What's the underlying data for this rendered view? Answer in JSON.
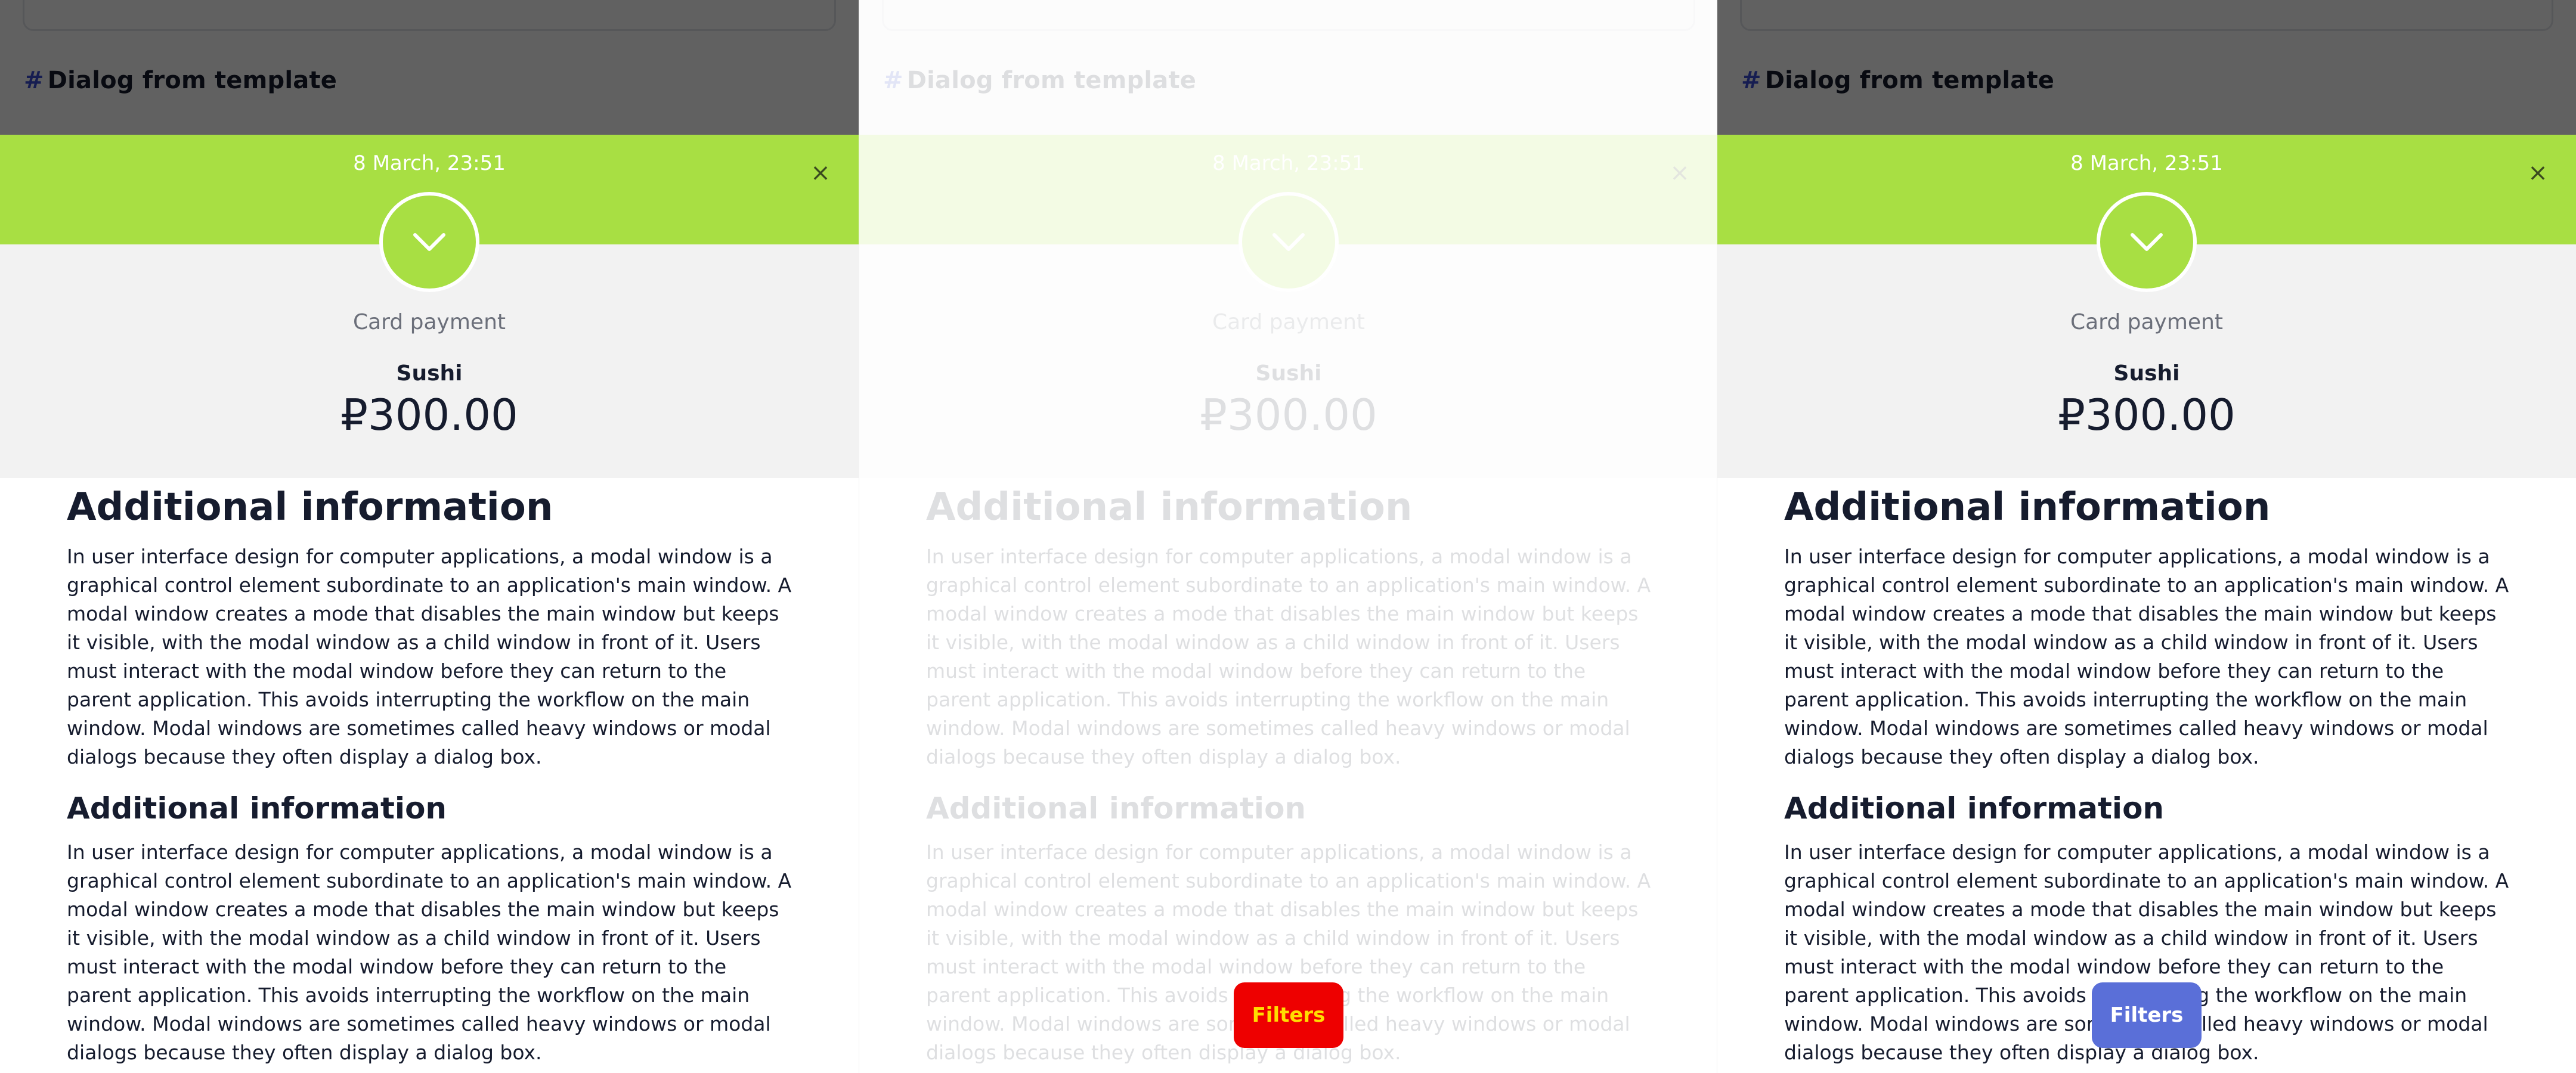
{
  "section": {
    "hash": "#",
    "title": "Dialog from template"
  },
  "dialog": {
    "datetime": "8 March, 23:51",
    "close_label": "×",
    "status_icon": "chevron-down-icon",
    "payment_method": "Card payment",
    "item": "Sushi",
    "amount": "₽300.00"
  },
  "content": {
    "heading_large": "Additional information",
    "heading_medium": "Additional information",
    "paragraph": "In user interface design for computer applications, a modal window is a graphical control element subordinate to an application's main window. A modal window creates a mode that disables the main window but keeps it visible, with the modal window as a child window in front of it. Users must interact with the modal window before they can return to the parent application. This avoids interrupting the workflow on the main window. Modal windows are sometimes called heavy windows or modal dialogs because they often display a dialog box."
  },
  "filters_button": {
    "label": "Filters"
  },
  "colors": {
    "accent_green": "#a8df43",
    "button_blue": "#5a6fd8",
    "text_dark": "#161c2e"
  }
}
